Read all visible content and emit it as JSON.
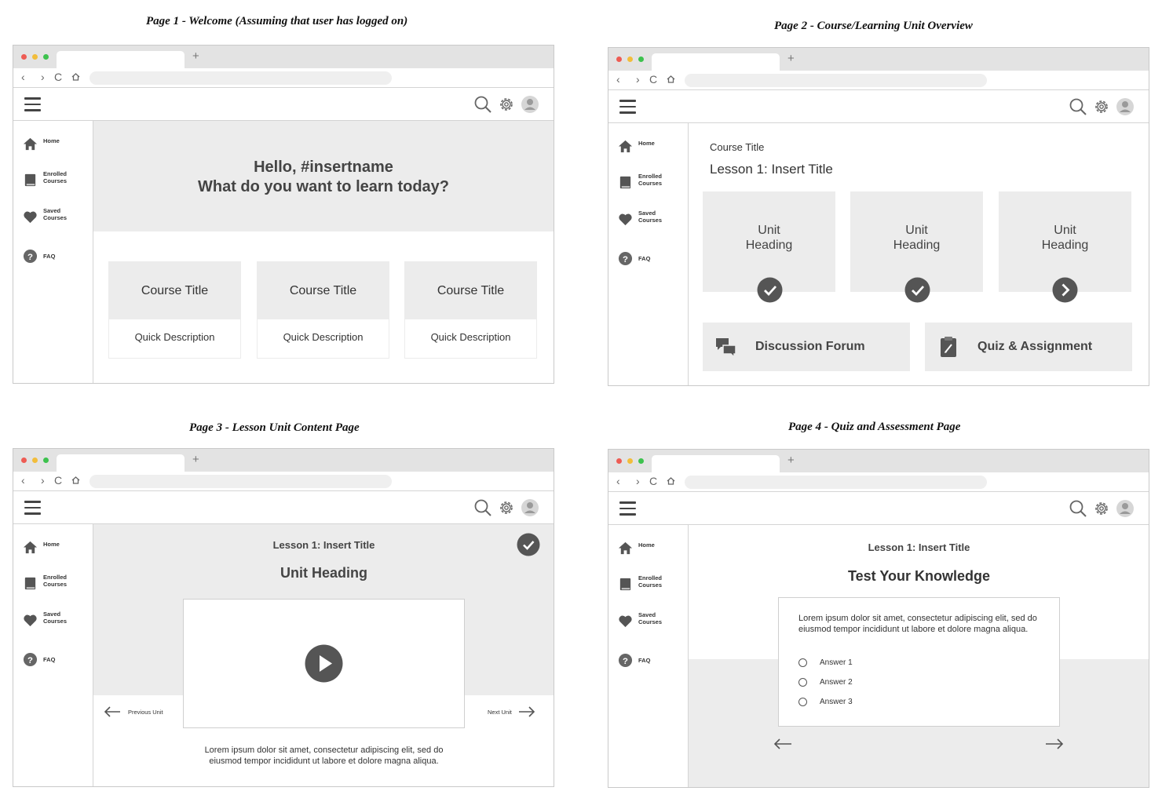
{
  "captions": {
    "page1": "Page 1 - Welcome (Assuming that user has logged on)",
    "page2": "Page 2 - Course/Learning Unit Overview",
    "page3": "Page 3 - Lesson Unit Content Page",
    "page4": "Page 4 - Quiz and Assessment Page"
  },
  "browser": {
    "new_tab": "+",
    "nav": {
      "back": "‹",
      "forward": "›",
      "reload": "C"
    }
  },
  "sidebar": {
    "home": "Home",
    "enrolled": "Enrolled Courses",
    "saved": "Saved Courses",
    "faq": "FAQ"
  },
  "page1": {
    "greeting": "Hello, #insertname",
    "prompt": "What do you want to learn today?",
    "cards": [
      {
        "title": "Course Title",
        "desc": "Quick Description"
      },
      {
        "title": "Course Title",
        "desc": "Quick Description"
      },
      {
        "title": "Course Title",
        "desc": "Quick Description"
      }
    ]
  },
  "page2": {
    "course_title": "Course Title",
    "lesson_title": "Lesson 1: Insert Title",
    "units": [
      {
        "heading": "Unit\nHeading",
        "status": "completed"
      },
      {
        "heading": "Unit\nHeading",
        "status": "completed"
      },
      {
        "heading": "Unit\nHeading",
        "status": "next"
      }
    ],
    "discussion": "Discussion Forum",
    "quiz": "Quiz & Assignment"
  },
  "page3": {
    "lesson_title": "Lesson 1: Insert Title",
    "unit_heading": "Unit Heading",
    "prev": "Previous Unit",
    "next": "Next Unit",
    "body": "Lorem ipsum dolor sit amet, consectetur adipiscing elit, sed do eiusmod tempor incididunt ut labore et dolore magna aliqua."
  },
  "page4": {
    "lesson_title": "Lesson 1: Insert Title",
    "title": "Test Your Knowledge",
    "question": "Lorem ipsum dolor sit amet, consectetur adipiscing elit, sed do eiusmod tempor incididunt ut labore et dolore magna aliqua.",
    "answers": [
      "Answer 1",
      "Answer 2",
      "Answer 3"
    ]
  },
  "colors": {
    "panel_gray": "#ececec",
    "icon_dark": "#555555",
    "traffic_red": "#ee5c54",
    "traffic_yellow": "#f2bd3b",
    "traffic_green": "#3dc24e"
  }
}
